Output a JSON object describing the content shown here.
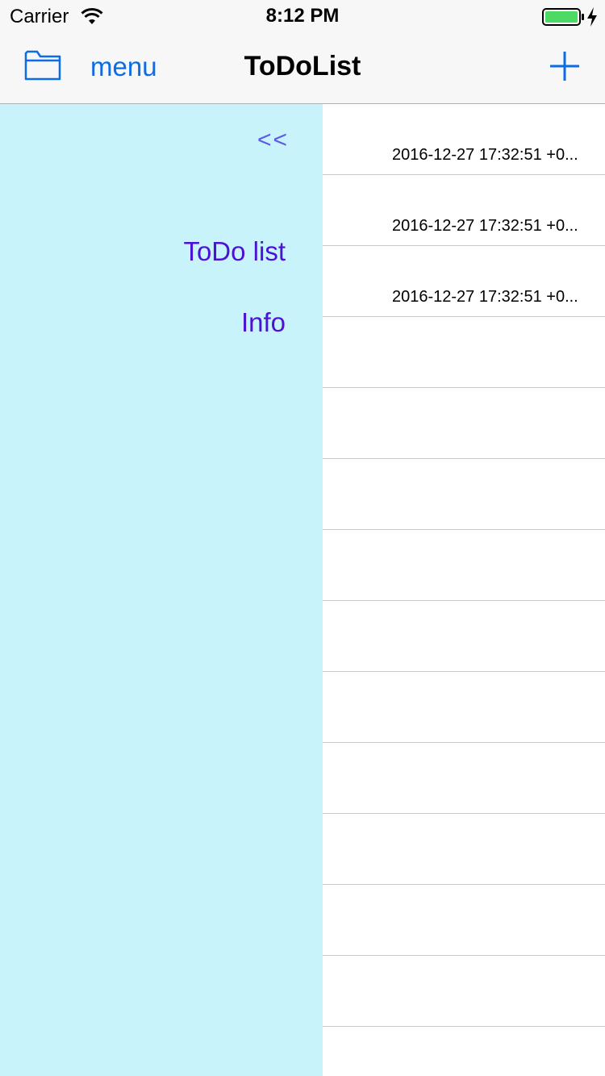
{
  "status_bar": {
    "carrier": "Carrier",
    "time": "8:12 PM",
    "battery_color": "#4cd964"
  },
  "nav_bar": {
    "menu_label": "menu",
    "title": "ToDoList",
    "accent_color": "#0b6ce6",
    "left_icon": "folder-icon",
    "right_icon": "add-icon"
  },
  "side_menu": {
    "collapse_label": "<<",
    "items": [
      {
        "label": "ToDo list"
      },
      {
        "label": "Info"
      }
    ],
    "background_color": "#c8f3fa",
    "item_color": "#4b12d6"
  },
  "table": {
    "rows": [
      {
        "date": "2016-12-27 17:32:51 +0..."
      },
      {
        "date": "2016-12-27 17:32:51 +0..."
      },
      {
        "date": "2016-12-27 17:32:51 +0..."
      },
      {
        "date": ""
      },
      {
        "date": ""
      },
      {
        "date": ""
      },
      {
        "date": ""
      },
      {
        "date": ""
      },
      {
        "date": ""
      },
      {
        "date": ""
      },
      {
        "date": ""
      },
      {
        "date": ""
      },
      {
        "date": ""
      }
    ]
  }
}
